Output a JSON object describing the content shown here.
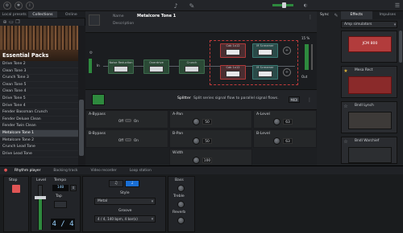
{
  "topbar": {
    "icons": [
      "gear-icon",
      "settings-icon",
      "info-icon",
      "mic-icon",
      "guitar-icon",
      "menu-icon"
    ]
  },
  "left": {
    "tabs": [
      "Local presets",
      "Collections",
      "Online"
    ],
    "active_tab": 1,
    "banner": "Essential Packs",
    "items": [
      "Drive Tone 2",
      "Clean Tone 3",
      "Crunch Tone 3",
      "Clean Tone 5",
      "Clean Tone 4",
      "Drive Tone 5",
      "Drive Tone 4",
      "Fender Bassman Crunch",
      "Fender Deluxe Clean",
      "Fender Twin Clean",
      "Metalcore Tone 1",
      "Metalcore Tone 2",
      "Crunch Lead Tone",
      "Drive Lead Tone"
    ],
    "selected_index": 10
  },
  "header": {
    "name_label": "Name",
    "name_value": "Metalcore Tone 1",
    "desc_label": "Description",
    "desc_value": "",
    "sync_label": "Sync",
    "zoom": "15 %",
    "in_label": "In",
    "out_label": "Out"
  },
  "chain": {
    "blocks": [
      "Noise Reduction",
      "Overdrive",
      "Crunch"
    ],
    "split_top": [
      "Cab 1x12",
      "M Screamer"
    ],
    "split_bottom": [
      "Cab 1x12",
      "M Screamer"
    ]
  },
  "splitter": {
    "title": "Splitter",
    "desc": "Split series signal flow to parallel signal flows.",
    "mode": "MIDI",
    "params": [
      {
        "name": "A-Bypass",
        "toggle": "Off",
        "state": "On"
      },
      {
        "name": "A-Pan",
        "value": "50"
      },
      {
        "name": "A-Level",
        "value": "63"
      },
      {
        "name": "B-Bypass",
        "toggle": "Off",
        "state": "On"
      },
      {
        "name": "B-Pan",
        "value": "50"
      },
      {
        "name": "B-Level",
        "value": "63"
      },
      {
        "name": "Width",
        "value": "100"
      }
    ]
  },
  "right": {
    "tabs": [
      "Effects",
      "Impulses"
    ],
    "dropdown": "Amp simulators",
    "amps": [
      "JCM 800",
      "Mesa Rect",
      "Bndl Lynch",
      "Bndl Warchief"
    ]
  },
  "bottom": {
    "tabs": [
      "Rhythm player",
      "Backing track",
      "Video recorder",
      "Loop station"
    ],
    "active_tab": 0,
    "stop_label": "Stop",
    "level_label": "Level",
    "tempo_label": "Tempo",
    "tempo_value": "140",
    "tap_label": "Tap",
    "time_sig": "4 / 4",
    "style_label": "Style",
    "style_value": "Metal",
    "groove_label": "Groove",
    "groove_value": "4 / 4, 140 bpm, 4 bar(s)",
    "bass_label": "Bass",
    "treble_label": "Treble",
    "reverb_label": "Reverb"
  }
}
